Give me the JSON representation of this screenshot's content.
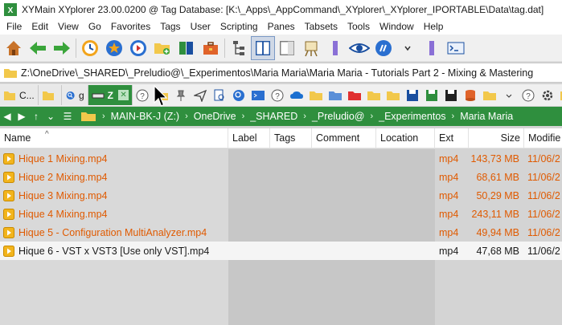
{
  "window": {
    "title": "XYMain XYplorer 23.00.0200 @ Tag Database: [K:\\_Apps\\_AppCommand\\_XYplorer\\_XYplorer_IPORTABLE\\Data\\tag.dat]"
  },
  "menu": [
    "File",
    "Edit",
    "View",
    "Go",
    "Favorites",
    "Tags",
    "User",
    "Scripting",
    "Panes",
    "Tabsets",
    "Tools",
    "Window",
    "Help"
  ],
  "address": {
    "path": "Z:\\OneDrive\\_SHARED\\_Preludio@\\_Experimentos\\Maria Maria\\Maria Maria - Tutorials Part 2 - Mixing & Mastering"
  },
  "tabs": [
    {
      "label": "C...",
      "active": false
    },
    {
      "label": "",
      "active": false
    },
    {
      "label": "g",
      "active": false
    },
    {
      "label": "Z",
      "active": true
    }
  ],
  "breadcrumb": [
    "MAIN-BK-J (Z:)",
    "OneDrive",
    "_SHARED",
    "_Preludio@",
    "_Experimentos",
    "Maria Maria"
  ],
  "columns": {
    "name": "Name",
    "label": "Label",
    "tags": "Tags",
    "comment": "Comment",
    "location": "Location",
    "ext": "Ext",
    "size": "Size",
    "modified": "Modifie"
  },
  "files": [
    {
      "name": "Hique 1 Mixing.mp4",
      "ext": "mp4",
      "size": "143,73 MB",
      "modified": "11/06/2"
    },
    {
      "name": "Hique 2 Mixing.mp4",
      "ext": "mp4",
      "size": "68,61 MB",
      "modified": "11/06/2"
    },
    {
      "name": "Hique 3 Mixing.mp4",
      "ext": "mp4",
      "size": "50,29 MB",
      "modified": "11/06/2"
    },
    {
      "name": "Hique 4 Mixing.mp4",
      "ext": "mp4",
      "size": "243,11 MB",
      "modified": "11/06/2"
    },
    {
      "name": "Hique 5 - Configuration MultiAnalyzer.mp4",
      "ext": "mp4",
      "size": "49,94 MB",
      "modified": "11/06/2"
    },
    {
      "name": "Hique 6 - VST x VST3 [Use only VST].mp4",
      "ext": "mp4",
      "size": "47,68 MB",
      "modified": "11/06/2"
    }
  ],
  "colors": {
    "accent_green": "#2f8f3e",
    "file_orange": "#e05a00"
  }
}
